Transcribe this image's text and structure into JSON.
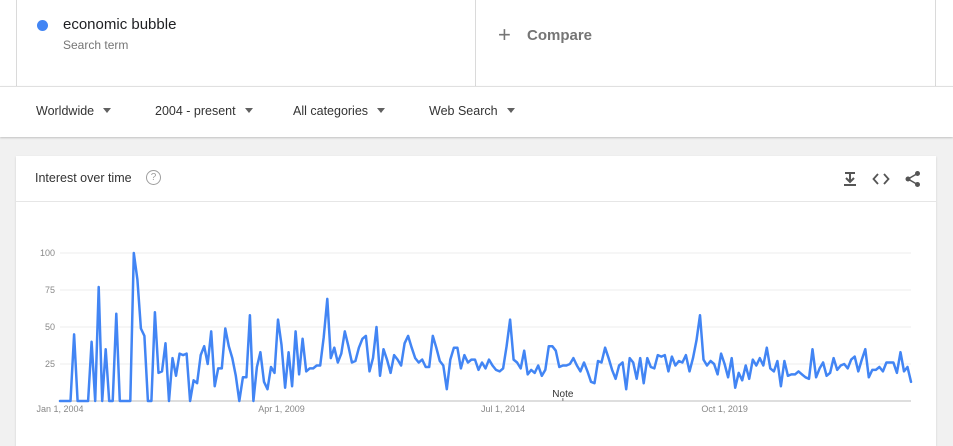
{
  "search_term": {
    "name": "economic bubble",
    "subtitle": "Search term",
    "color": "#4285f4"
  },
  "compare": {
    "label": "Compare"
  },
  "filters": {
    "region": "Worldwide",
    "period": "2004 - present",
    "category": "All categories",
    "search_type": "Web Search"
  },
  "card": {
    "title": "Interest over time",
    "help_glyph": "?",
    "icons": [
      "download-icon",
      "embed-icon",
      "share-icon"
    ],
    "note_label": "Note"
  },
  "chart_data": {
    "type": "line",
    "series": [
      {
        "name": "economic bubble",
        "color": "#4285f4",
        "values": [
          0,
          0,
          0,
          0,
          45,
          0,
          0,
          0,
          0,
          40,
          0,
          77,
          0,
          35,
          0,
          0,
          59,
          0,
          0,
          0,
          0,
          100,
          82,
          49,
          44,
          0,
          0,
          60,
          19,
          20,
          39,
          0,
          29,
          17,
          32,
          31,
          32,
          0,
          14,
          12,
          31,
          37,
          25,
          47,
          10,
          22,
          22,
          49,
          37,
          29,
          17,
          0,
          16,
          16,
          58,
          0,
          23,
          33,
          13,
          8,
          23,
          19,
          55,
          38,
          9,
          33,
          10,
          47,
          18,
          42,
          20,
          22,
          22,
          24,
          24,
          43,
          69,
          29,
          36,
          26,
          32,
          47,
          37,
          26,
          27,
          36,
          42,
          44,
          20,
          29,
          50,
          17,
          35,
          28,
          19,
          31,
          28,
          24,
          39,
          44,
          36,
          29,
          26,
          28,
          23,
          23,
          44,
          36,
          27,
          24,
          8,
          28,
          36,
          36,
          22,
          31,
          26,
          28,
          28,
          21,
          26,
          22,
          28,
          24,
          21,
          20,
          22,
          37,
          55,
          28,
          26,
          22,
          34,
          18,
          21,
          19,
          24,
          17,
          21,
          37,
          37,
          34,
          23,
          24,
          24,
          25,
          29,
          24,
          20,
          26,
          20,
          13,
          12,
          27,
          26,
          36,
          29,
          21,
          15,
          24,
          26,
          8,
          29,
          26,
          15,
          29,
          12,
          29,
          23,
          22,
          31,
          30,
          31,
          20,
          30,
          24,
          27,
          26,
          31,
          20,
          29,
          41,
          58,
          28,
          24,
          27,
          25,
          18,
          32,
          25,
          16,
          29,
          9,
          19,
          14,
          24,
          15,
          28,
          24,
          29,
          24,
          36,
          22,
          20,
          27,
          10,
          27,
          17,
          18,
          18,
          20,
          18,
          16,
          15,
          35,
          16,
          22,
          26,
          17,
          19,
          29,
          21,
          24,
          25,
          22,
          28,
          30,
          20,
          28,
          35,
          16,
          21,
          21,
          23,
          20,
          26,
          26,
          26,
          19,
          33,
          20,
          23,
          13
        ]
      }
    ],
    "ylim": [
      0,
      100
    ],
    "y_ticks": [
      {
        "value": 25,
        "label": "25"
      },
      {
        "value": 50,
        "label": "50"
      },
      {
        "value": 75,
        "label": "75"
      },
      {
        "value": 100,
        "label": "100"
      }
    ],
    "x_ticks": [
      {
        "index": 0,
        "label": "Jan 1, 2004"
      },
      {
        "index": 63,
        "label": "Apr 1, 2009"
      },
      {
        "index": 126,
        "label": "Jul 1, 2014"
      },
      {
        "index": 189,
        "label": "Oct 1, 2019"
      }
    ],
    "grid": true
  }
}
